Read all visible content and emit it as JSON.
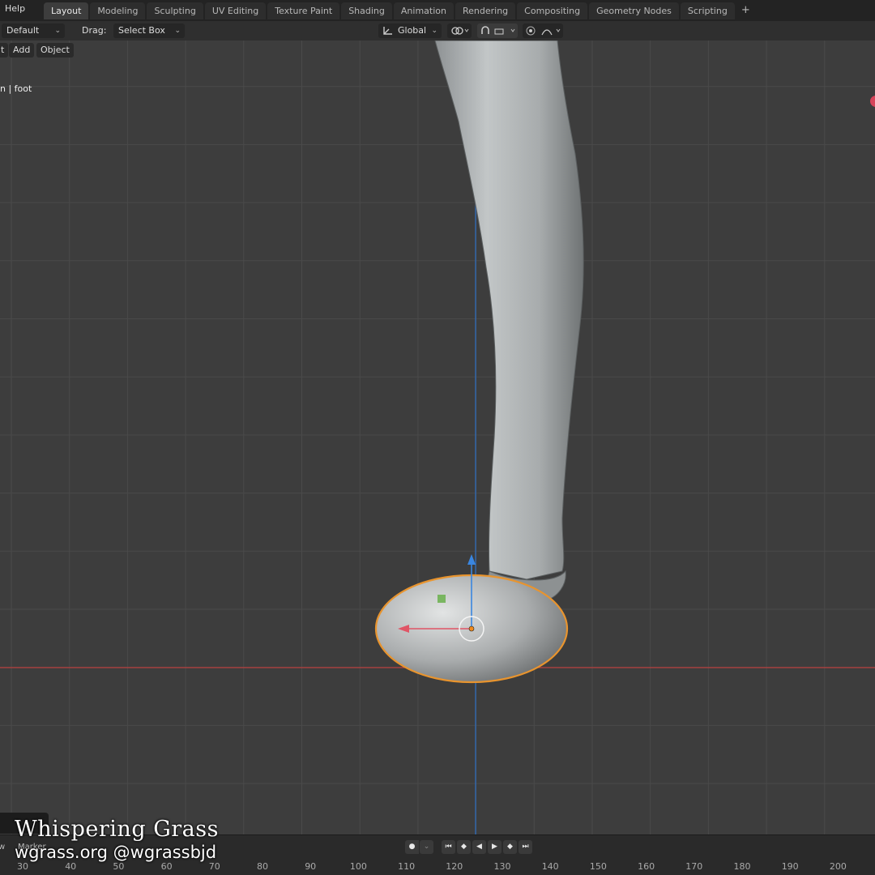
{
  "topbar": {
    "help_label": "Help",
    "tabs": [
      {
        "label": "Layout",
        "active": true
      },
      {
        "label": "Modeling"
      },
      {
        "label": "Sculpting"
      },
      {
        "label": "UV Editing"
      },
      {
        "label": "Texture Paint"
      },
      {
        "label": "Shading"
      },
      {
        "label": "Animation"
      },
      {
        "label": "Rendering"
      },
      {
        "label": "Compositing"
      },
      {
        "label": "Geometry Nodes"
      },
      {
        "label": "Scripting"
      }
    ],
    "add_tab_label": "+"
  },
  "toolbar": {
    "mode_value": "Default",
    "drag_label": "Drag:",
    "drag_value": "Select Box",
    "orientation_value": "Global"
  },
  "viewport": {
    "menu_partial": "t",
    "menu_add": "Add",
    "menu_object": "Object",
    "object_info": "n | foot",
    "colors": {
      "background": "#3d3d3d",
      "grid": "#4a4a4a",
      "x_axis": "#b8403f",
      "z_axis": "#2d6fc4",
      "selection_outline": "#e8942e",
      "gizmo_x": "#e05566",
      "gizmo_z": "#3a86e0"
    }
  },
  "timeline": {
    "view_partial": "w",
    "marker_label": "Marker",
    "frame_ticks": [
      "30",
      "40",
      "50",
      "60",
      "70",
      "80",
      "90",
      "100",
      "110",
      "120",
      "130",
      "140",
      "150",
      "160",
      "170",
      "180",
      "190",
      "200"
    ]
  },
  "watermark": {
    "title": "Whispering Grass",
    "subtitle": "wgrass.org @wgrassbjd"
  }
}
